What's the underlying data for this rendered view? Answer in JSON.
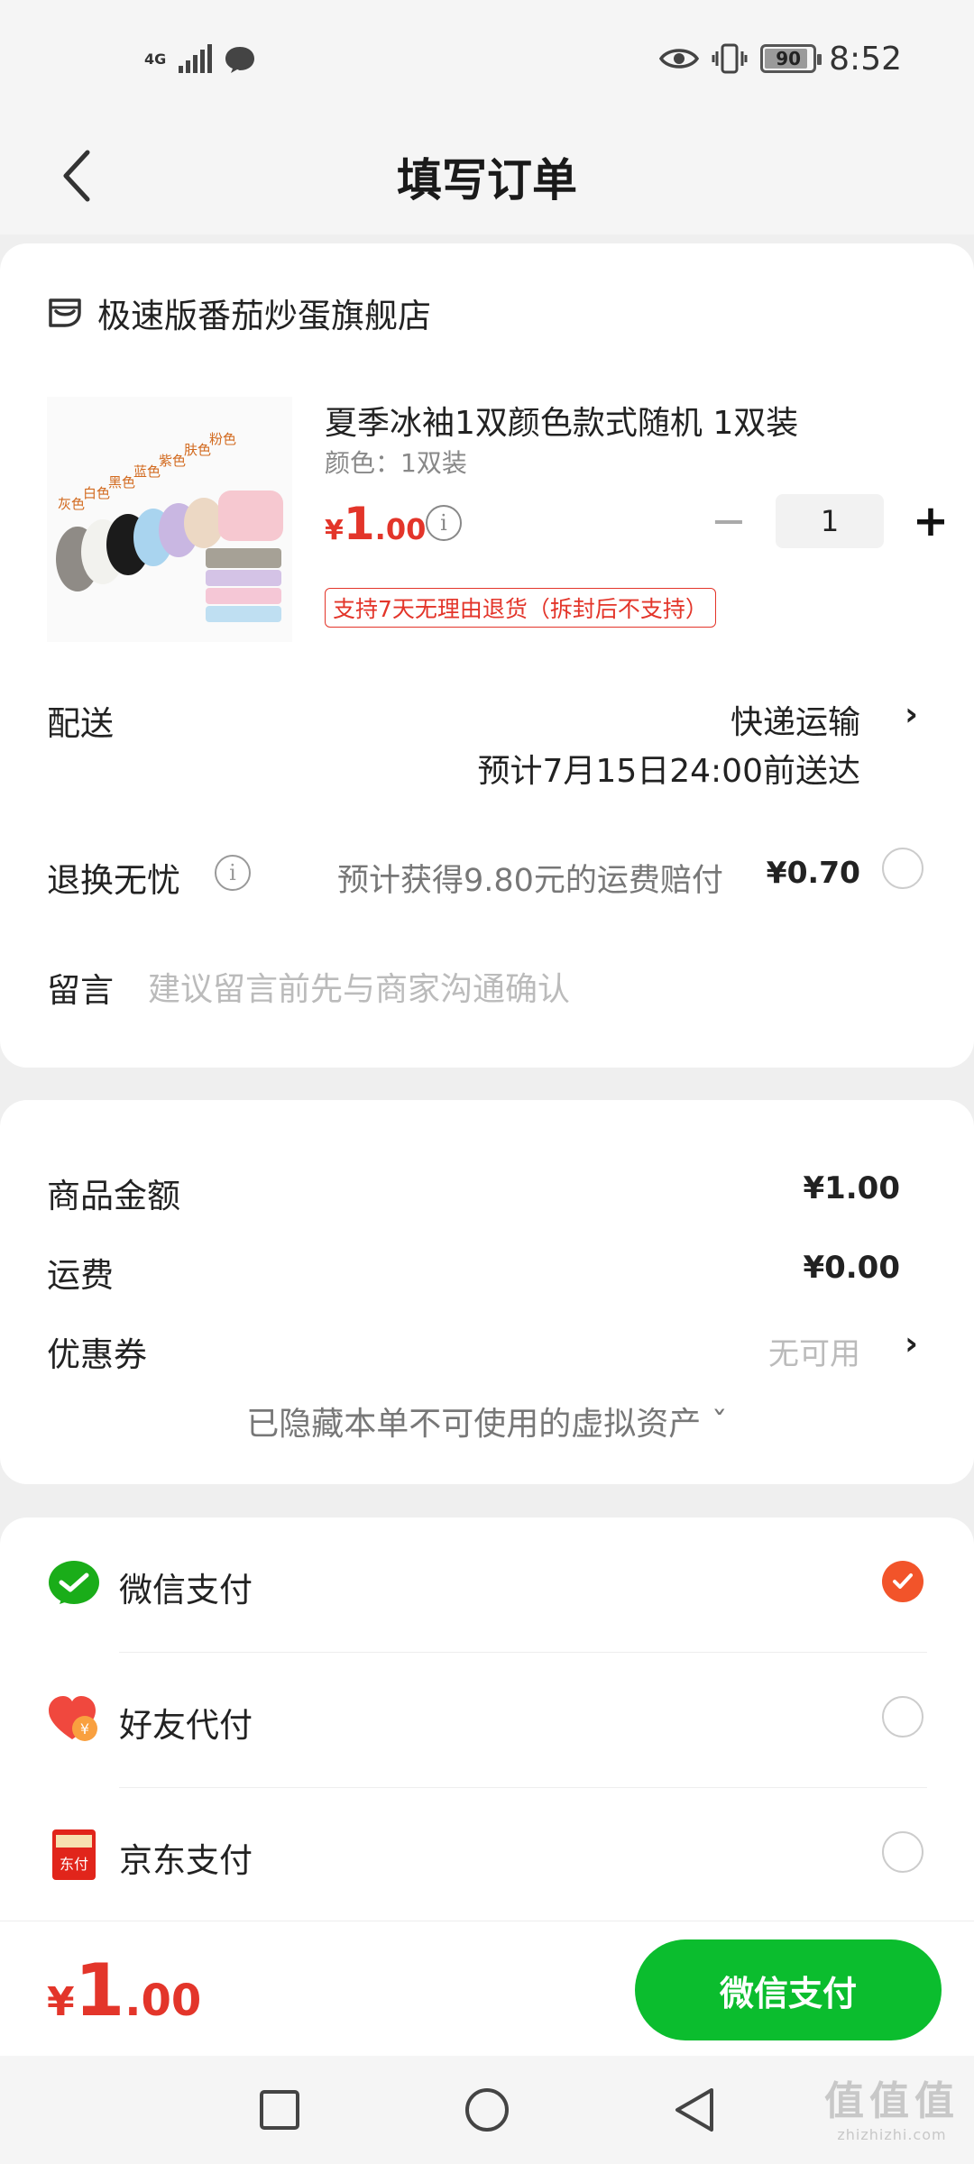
{
  "status_bar": {
    "network": "4G",
    "battery": "90",
    "battery_level": 0.9,
    "time": "8:52"
  },
  "header": {
    "title": "填写订单"
  },
  "shop": {
    "name": "极速版番茄炒蛋旗舰店"
  },
  "product": {
    "title": "夏季冰袖1双颜色款式随机 1双装",
    "spec": "颜色：1双装",
    "price_yen": "¥",
    "price_int": "1",
    "price_dec": ".00",
    "quantity": "1",
    "minus": "−",
    "plus": "+",
    "return_policy": "支持7天无理由退货（拆封后不支持）",
    "image_labels": [
      "灰色",
      "白色",
      "黑色",
      "蓝色",
      "紫色",
      "肤色",
      "粉色"
    ]
  },
  "delivery": {
    "label": "配送",
    "method": "快递运输",
    "eta": "预计7月15日24:00前送达"
  },
  "return_insurance": {
    "label": "退换无忧",
    "text": "预计获得9.80元的运费赔付",
    "price": "¥0.70"
  },
  "message": {
    "label": "留言",
    "placeholder": "建议留言前先与商家沟通确认"
  },
  "summary": {
    "goods_label": "商品金额",
    "goods_value": "¥1.00",
    "shipping_label": "运费",
    "shipping_value": "¥0.00",
    "coupon_label": "优惠券",
    "coupon_value": "无可用",
    "hidden_assets": "已隐藏本单不可使用的虚拟资产 ˇ"
  },
  "payment_methods": [
    {
      "label": "微信支付",
      "icon": "wechat-pay-icon",
      "selected": true
    },
    {
      "label": "好友代付",
      "icon": "friend-pay-icon",
      "selected": false
    },
    {
      "label": "京东支付",
      "icon": "jd-pay-icon",
      "selected": false,
      "icon_text": "东付"
    }
  ],
  "bottom": {
    "total_yen": "¥",
    "total_int": "1",
    "total_dec": ".00",
    "pay_button": "微信支付"
  },
  "watermark": {
    "big": "值值值",
    "small": "zhizhizhi.com"
  },
  "colors": {
    "accent_red": "#e3352a",
    "wechat_green": "#0bbd2e",
    "radio_orange": "#f2542a"
  }
}
